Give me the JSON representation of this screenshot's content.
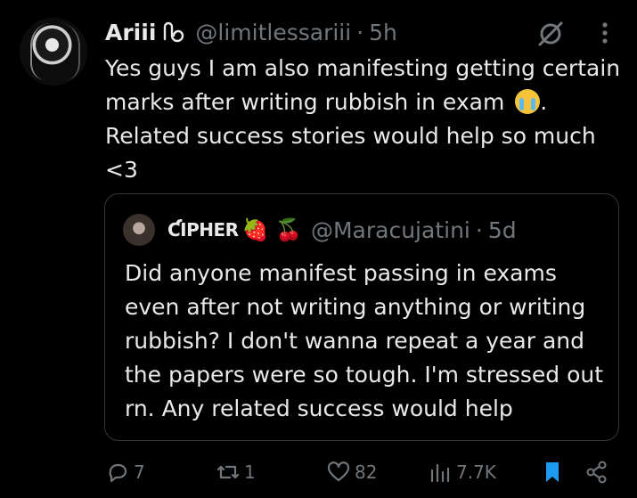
{
  "post": {
    "author_name": "Ariii",
    "handle": "@limitlessariii",
    "separator": "·",
    "time": "5h",
    "text": "Yes guys I am also manifesting getting certain marks after writing rubbish in exam",
    "text_emoji": "loudly-crying-face",
    "text_tail": ".\nRelated success stories would help so much <3"
  },
  "quoted": {
    "author_name": "ƇIPHER",
    "emoji": "🍓 🍒",
    "handle": "@Maracujatini",
    "separator": "·",
    "time": "5d",
    "text": "Did anyone manifest passing in exams even after not writing anything or writing rubbish? I don't wanna repeat a year and the papers were so tough. I'm stressed out rn. Any related success would help"
  },
  "actions": {
    "replies": "7",
    "reposts": "1",
    "likes": "82",
    "views": "7.7K"
  },
  "colors": {
    "background": "#000000",
    "text": "#e7e9ea",
    "muted": "#71767b",
    "bookmark": "#1d9bf0"
  },
  "icons": [
    "grok-icon",
    "more-icon",
    "reply-icon",
    "repost-icon",
    "like-icon",
    "views-icon",
    "bookmark-icon",
    "share-icon",
    "loudly-crying-face-icon"
  ]
}
